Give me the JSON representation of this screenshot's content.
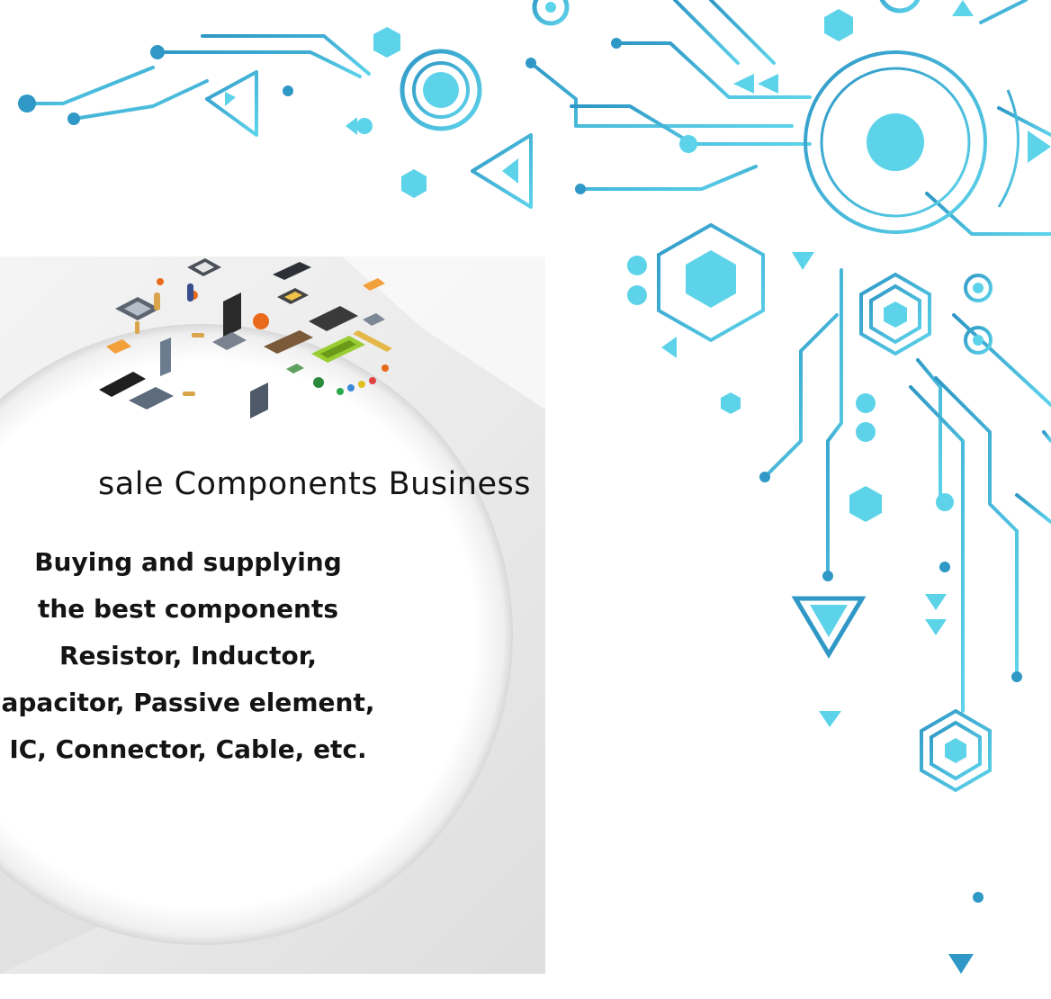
{
  "card": {
    "title": "sale Components Business",
    "lines": [
      "Buying and supplying",
      "the best components",
      "Resistor, Inductor,",
      "apacitor, Passive element,",
      "IC, Connector, Cable, etc."
    ]
  },
  "colors": {
    "circuit_dark": "#2f98c6",
    "circuit_light": "#5dd3ea",
    "card_background": "#ececec",
    "text": "#141414"
  },
  "icons": [
    "circuit-board-decoration",
    "electronic-components-illustration"
  ]
}
